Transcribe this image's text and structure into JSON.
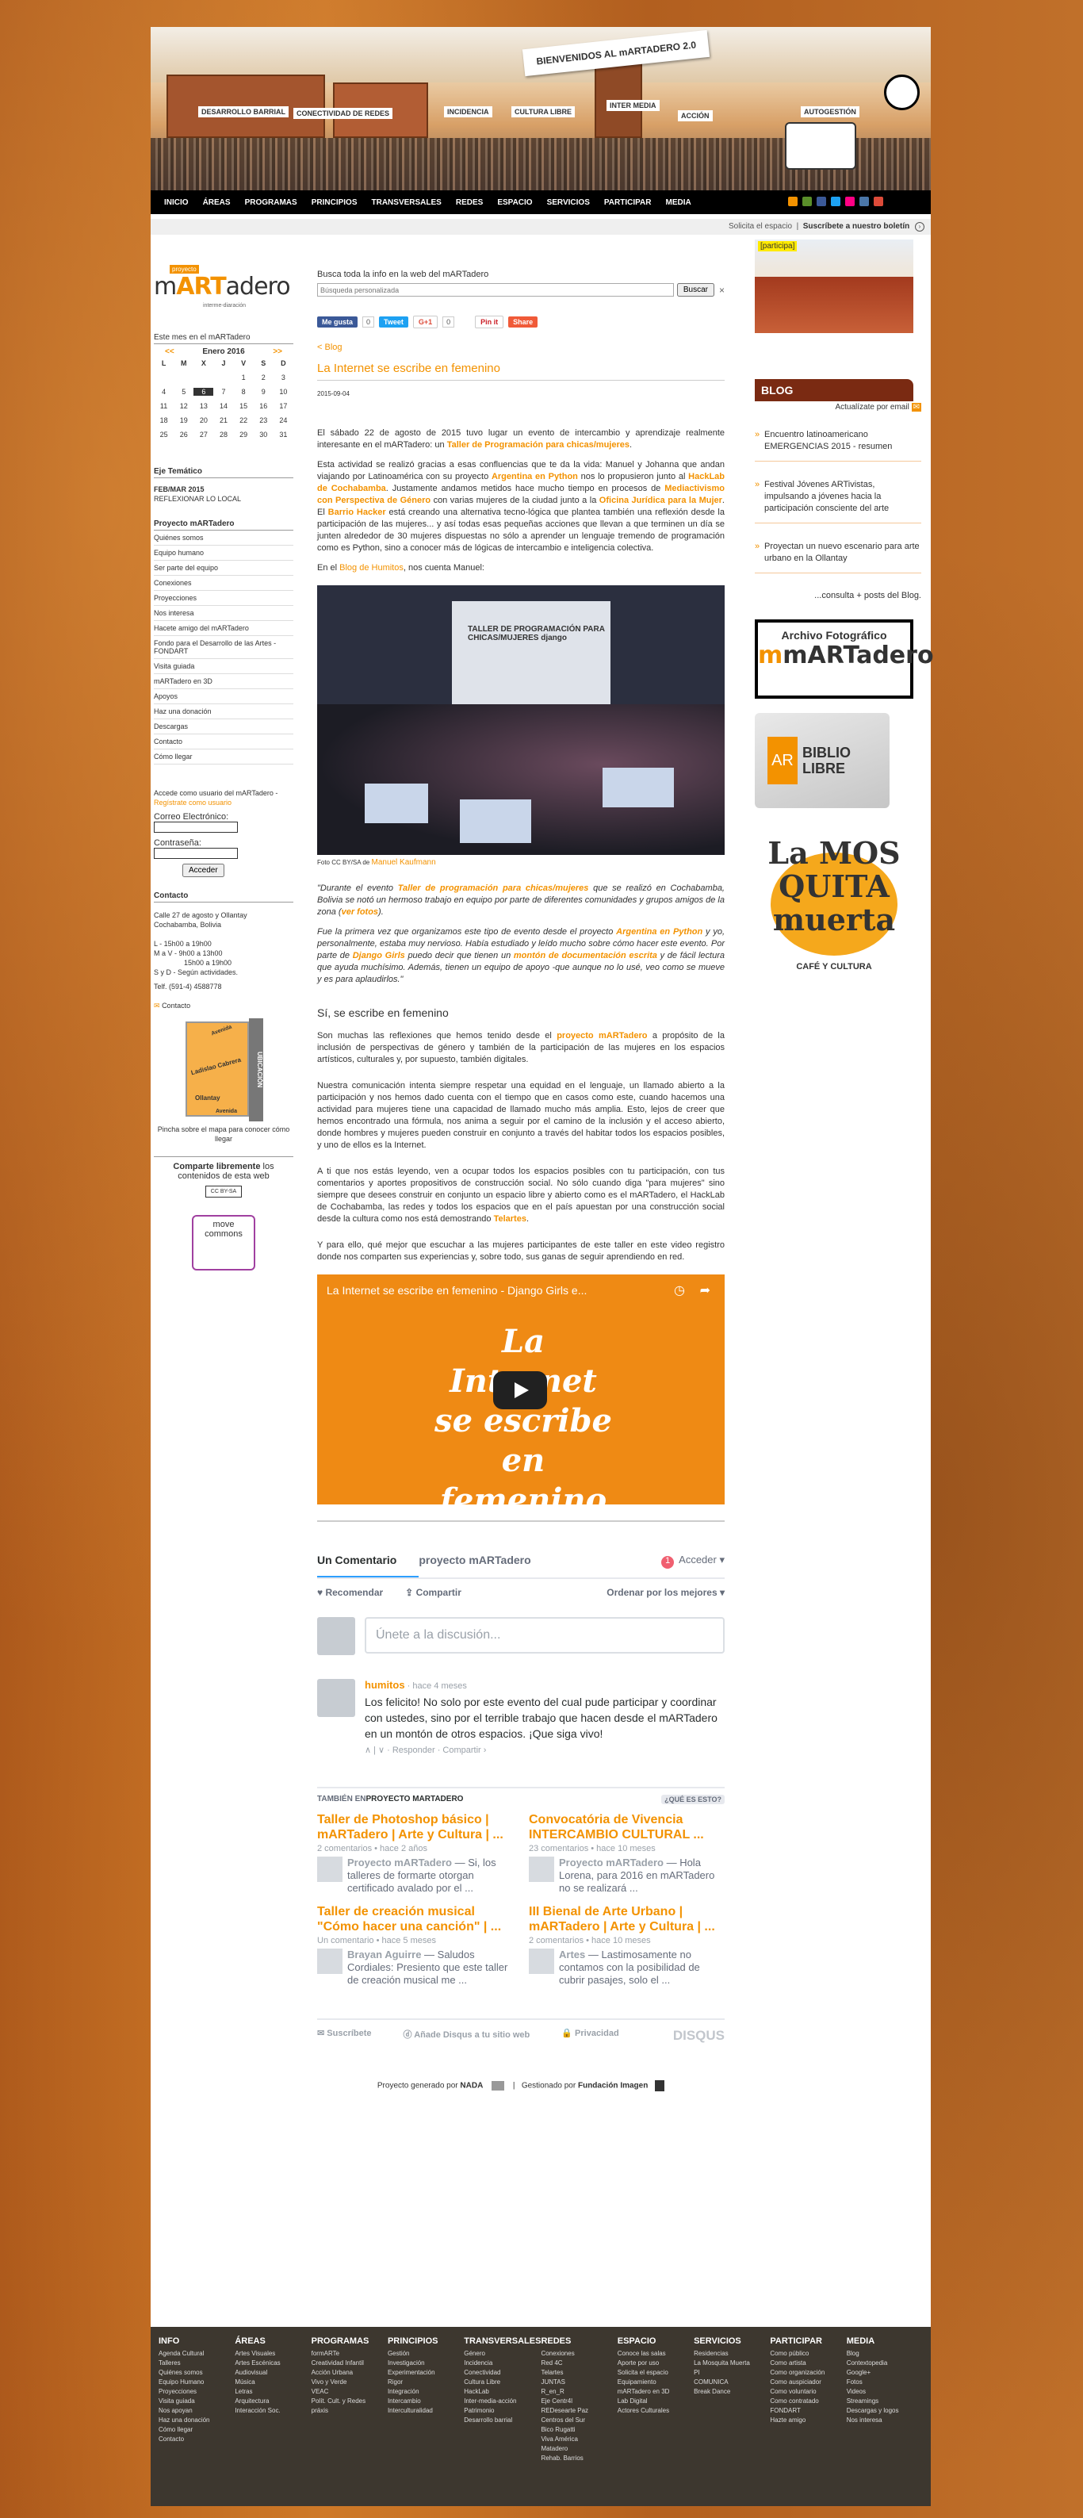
{
  "header": {
    "welcome": "BIENVENIDOS AL mARTADERO 2.0",
    "tags": [
      "DESARROLLO BARRIAL",
      "CONECTIVIDAD DE REDES",
      "INCIDENCIA",
      "CULTURA LIBRE",
      "INTER MEDIA",
      "ACCIÓN",
      "AUTOGESTIÓN"
    ]
  },
  "nav": {
    "items": [
      "INICIO",
      "ÁREAS",
      "PROGRAMAS",
      "PRINCIPIOS",
      "TRANSVERSALES",
      "REDES",
      "ESPACIO",
      "SERVICIOS",
      "PARTICIPAR",
      "MEDIA"
    ]
  },
  "subbar": {
    "request": "Solicita el espacio",
    "subscribe": "Suscríbete a nuestro boletín"
  },
  "left": {
    "logo_proj": "proyecto",
    "logo_main": "mARTadero",
    "logo_sub": "interme-diaración",
    "month_title": "Este mes en el mARTadero",
    "cal_prev": "<<",
    "cal_month": "Enero 2016",
    "cal_next": ">>",
    "cal_days": [
      "L",
      "M",
      "X",
      "J",
      "V",
      "S",
      "D"
    ],
    "cal_cells": [
      "",
      "",
      "",
      "",
      "1",
      "2",
      "3",
      "4",
      "5",
      "6",
      "7",
      "8",
      "9",
      "10",
      "11",
      "12",
      "13",
      "14",
      "15",
      "16",
      "17",
      "18",
      "19",
      "20",
      "21",
      "22",
      "23",
      "24",
      "25",
      "26",
      "27",
      "28",
      "29",
      "30",
      "31"
    ],
    "today": "6",
    "eje_title": "Eje Temático",
    "eje_date": "FEB/MAR 2015",
    "eje_text": "REFLEXIONAR LO LOCAL",
    "proj_title": "Proyecto mARTadero",
    "menu": [
      "Quiénes somos",
      "Equipo humano",
      "Ser parte del equipo",
      "Conexiones",
      "Proyecciones",
      "Nos interesa",
      "Hacete amigo del mARTadero",
      "Fondo para el Desarrollo de las Artes - FONDART",
      "Visita guiada",
      "mARTadero en 3D",
      "Apoyos",
      "Haz una donación",
      "Descargas",
      "Contacto",
      "Cómo llegar"
    ],
    "access_text": "Accede como usuario del mARTadero -",
    "register": "Regístrate como usuario",
    "email_label": "Correo Electrónico:",
    "pass_label": "Contraseña:",
    "login_button": "Acceder",
    "contact_title": "Contacto",
    "contact_address": "Calle 27 de agosto y Ollantay Cochabamba, Bolivia",
    "contact_hours": [
      "L - 15h00 a 19h00",
      "M a V - 9h00 a 13h00",
      "15h00 a 19h00",
      "S y D - Según actividades."
    ],
    "contact_tel": "Telf. (591-4) 4588778",
    "contact_link": "Contacto",
    "map_side": "UBICACIÓN",
    "map_streets": [
      "Ladislao Cabrera",
      "Ollantay",
      "Avenida",
      "Avenida"
    ],
    "map_caption": "Pincha sobre el mapa para conocer cómo llegar",
    "share_bold": "Comparte libremente",
    "share_rest": " los contenidos de esta web",
    "cc_badge": "CC BY-SA",
    "move_commons": "move commons"
  },
  "main": {
    "search_label": "Busca toda la info en la web del mARTadero",
    "search_placeholder": "Búsqueda personalizada",
    "search_button": "Buscar",
    "search_clear": "×",
    "fb_like": "Me gusta",
    "fb_count": "0",
    "tweet": "Tweet",
    "gplus": "G+1",
    "gplus_count": "0",
    "pin": "Pin it",
    "share": "Share",
    "back": "< Blog",
    "title": "La Internet se escribe en femenino",
    "date": "2015-09-04",
    "p1_a": "El sábado 22 de agosto de 2015 tuvo lugar un evento de intercambio y aprendizaje realmente interesante en el mARTadero: un ",
    "p1_link": "Taller de Programación para chicas/mujeres",
    "p1_b": ".",
    "p2_a": "Esta actividad se realizó gracias a esas confluencias que te da la vida: Manuel y Johanna que andan viajando por Latinoamérica con su proyecto ",
    "p2_l1": "Argentina en Python",
    "p2_b": " nos lo propusieron junto al ",
    "p2_l2": "HackLab de Cochabamba",
    "p2_c": ". Justamente andamos metidos hace mucho tiempo en procesos de ",
    "p2_l3": "Mediactivismo con Perspectiva de Género",
    "p2_d": " con varias mujeres de la ciudad junto a la ",
    "p2_l4": "Oficina Jurídica para la Mujer",
    "p2_e": ". El ",
    "p2_l5": "Barrio Hacker",
    "p2_f": " está creando una alternativa tecno-lógica que plantea también una reflexión desde la participación de las mujeres... y así todas esas pequeñas acciones que llevan a que terminen un día se junten alrededor de 30 mujeres dispuestas no sólo a aprender un lenguaje tremendo de programación como es Python, sino a conocer más de lógicas de intercambio e inteligencia colectiva.",
    "p3_a": "En el ",
    "p3_link": "Blog de Humitos",
    "p3_b": ", nos cuenta Manuel:",
    "photo_screen": "TALLER DE PROGRAMACIÓN PARA CHICAS/MUJERES django",
    "caption_a": "Foto CC BY/SA de ",
    "caption_link": "Manuel Kaufmann",
    "q1_a": "\"Durante el evento ",
    "q1_l1": "Taller de programación para chicas/mujeres",
    "q1_b": " que se realizó en Cochabamba, Bolivia se notó un hermoso trabajo en equipo por parte de diferentes comunidades y grupos amigos de la zona (",
    "q1_l2": "ver fotos",
    "q1_c": ").",
    "q2_a": "Fue la primera vez que organizamos este tipo de evento desde el proyecto ",
    "q2_l1": "Argentina en Python",
    "q2_b": " y yo, personalmente, estaba muy nervioso. Había estudiado y leído mucho sobre cómo hacer este evento. Por parte de ",
    "q2_l2": "Django Girls",
    "q2_c": " puedo decir que tienen un ",
    "q2_l3": "montón de documentación escrita",
    "q2_d": " y de fácil lectura que ayuda muchísimo. Además, tienen un equipo de apoyo -que aunque no lo usé, veo como se mueve y es para aplaudirlos.\"",
    "sub_title": "Sí, se escribe en femenino",
    "p4_a": "Son muchas las reflexiones que hemos tenido desde el ",
    "p4_link": "proyecto mARTadero",
    "p4_b": " a propósito de la inclusión de perspectivas de género y también de la participación de las mujeres en los espacios artísticos, culturales y, por supuesto, también digitales.",
    "p5": "Nuestra comunicación intenta siempre respetar una equidad en el lenguaje, un llamado abierto a la participación y nos hemos dado cuenta con el tiempo que en casos como este, cuando hacemos una actividad para mujeres tiene una capacidad de llamado mucho más amplia. Esto, lejos de creer que hemos encontrado una fórmula, nos anima a seguir por el camino de la inclusión y el acceso abierto, donde hombres y mujeres pueden construir en conjunto a través del habitar todos los espacios posibles, y uno de ellos es la Internet.",
    "p6_a": "A ti que nos estás leyendo, ven a ocupar todos los espacios posibles con tu participación, con tus comentarios y aportes propositivos de construcción social. No sólo cuando diga \"para mujeres\" sino siempre que desees construir en conjunto un espacio libre y abierto como es el mARTadero, el HackLab de Cochabamba, las redes y todos los espacios que en el país apuestan por una construcción social desde la cultura como nos está demostrando ",
    "p6_link": "Telartes",
    "p6_b": ".",
    "p7": "Y para ello, qué mejor que escuchar a las mujeres participantes de este taller en este video registro donde nos comparten sus experiencias y, sobre todo, sus ganas de seguir aprendiendo en red.",
    "video_title": "La Internet se escribe en femenino - Django Girls e...",
    "video_big": "La Internet se escribe en femenino"
  },
  "disqus": {
    "tab_comments": "Un Comentario",
    "tab_project": "proyecto mARTadero",
    "notif_count": "1",
    "login": "Acceder",
    "recommend": "Recomendar",
    "share": "Compartir",
    "sort": "Ordenar por los mejores",
    "placeholder": "Únete a la discusión...",
    "comment_author": "humitos",
    "comment_time": "hace 4 meses",
    "comment_text": "Los felicito! No solo por este evento del cual pude participar y coordinar con ustedes, sino por el terrible trabajo que hacen desde el mARTadero en un montón de otros espacios. ¡Que siga vivo!",
    "comment_actions": "∧ | ∨ · Responder · Compartir ›",
    "also_label": "TAMBIÉN EN ",
    "also_provider": "PROYECTO MARTADERO",
    "what_is": "¿QUÉ ES ESTO?",
    "related": [
      {
        "title": "Taller de Photoshop básico | mARTadero | Arte y Cultura | ...",
        "meta": "2 comentarios • hace 2 años",
        "author": "Proyecto mARTadero",
        "snippet": " — Si, los talleres de formarte otorgan certificado avalado por el ..."
      },
      {
        "title": "Convocatória de Vivencia INTERCAMBIO CULTURAL ...",
        "meta": "23 comentarios • hace 10 meses",
        "author": "Proyecto mARTadero",
        "snippet": " — Hola Lorena, para 2016 en mARTadero no se realizará ..."
      },
      {
        "title": "Taller de creación musical \"Cómo hacer una canción\" | ...",
        "meta": "Un comentario • hace 5 meses",
        "author": "Brayan Aguirre",
        "snippet": " — Saludos Cordiales: Presiento que este taller de creación musical me ..."
      },
      {
        "title": "III Bienal de Arte Urbano | mARTadero | Arte y Cultura | ...",
        "meta": "2 comentarios • hace 10 meses",
        "author": "Artes",
        "snippet": " — Lastimosamente no contamos con la posibilidad de cubrir pasajes, solo el ..."
      }
    ],
    "foot_subscribe": "Suscríbete",
    "foot_add": "Añade Disqus a tu sitio web",
    "foot_privacy": "Privacidad",
    "foot_logo": "DISQUS"
  },
  "generated": {
    "by_a": "Proyecto generado por ",
    "by_b": "NADA",
    "sep": "|",
    "managed_a": "Gestionado por ",
    "managed_b": "Fundación Imagen"
  },
  "right": {
    "participa": "[participa]",
    "blog_title": "BLOG",
    "blog_update": "Actualízate por email",
    "posts": [
      "Encuentro latinoamericano EMERGENCIAS 2015 - resumen",
      "Festival Jóvenes ARTivistas, impulsando a jóvenes hacia la participación consciente del arte",
      "Proyectan un nuevo escenario para arte urbano en la Ollantay"
    ],
    "more": "...consulta + posts del Blog.",
    "archivo_t1": "Archivo Fotográfico",
    "archivo_t2": "mARTadero",
    "biblio": "BIBLIO LIBRE",
    "biblio_ar": "AR",
    "mosquita": "La MOS QUITA muerta",
    "cafe": "CAFÉ Y CULTURA"
  },
  "footer": {
    "columns": [
      {
        "title": "INFO",
        "items": [
          "Agenda Cultural",
          "Talleres",
          "Quiénes somos",
          "Equipo Humano",
          "Proyecciones",
          "Visita guiada",
          "Nos apoyan",
          "Haz una donación",
          "Cómo llegar",
          "Contacto"
        ]
      },
      {
        "title": "ÁREAS",
        "items": [
          "Artes Visuales",
          "Artes Escénicas",
          "Audiovisual",
          "Música",
          "Letras",
          "Arquitectura",
          "Interacción Soc."
        ]
      },
      {
        "title": "PROGRAMAS",
        "items": [
          "formARTe",
          "Creatividad Infantil",
          "Acción Urbana",
          "Vivo y Verde",
          "VEAC",
          "Polít. Cult. y Redes",
          "práxis"
        ]
      },
      {
        "title": "PRINCIPIOS",
        "items": [
          "Gestión",
          "Investigación",
          "Experimentación",
          "Rigor",
          "Integración",
          "Intercambio",
          "Interculturalidad"
        ]
      },
      {
        "title": "TRANSVERSALES",
        "items": [
          "Género",
          "Incidencia",
          "Conectividad",
          "Cultura Libre",
          "HackLab",
          "Inter-media-acción",
          "Patrimonio",
          "Desarrollo barrial"
        ]
      },
      {
        "title": "REDES",
        "items": [
          "Conexiones",
          "Red 4C",
          "Telartes",
          "JUNTAS",
          "R_en_R",
          "Eje Centr4l",
          "REDesearte Paz",
          "Centros del Sur",
          "Bico Rugatti",
          "Viva América",
          "Matadero",
          "Rehab. Barrios"
        ]
      },
      {
        "title": "ESPACIO",
        "items": [
          "Conoce las salas",
          "Aporte por uso",
          "Solicita el espacio",
          "Equipamiento",
          "mARTadero en 3D",
          "Lab Digital",
          "Actores Culturales"
        ]
      },
      {
        "title": "SERVICIOS",
        "items": [
          "Residencias",
          "La Mosquita Muerta",
          "PI",
          "COMUNICA",
          "Break Dance"
        ]
      },
      {
        "title": "PARTICIPAR",
        "items": [
          "Como público",
          "Como artista",
          "Como organización",
          "Como auspiciador",
          "Como voluntario",
          "Como contratado",
          "FONDART",
          "Hazte amigo"
        ]
      },
      {
        "title": "MEDIA",
        "items": [
          "Blog",
          "Contextopedia",
          "Google+",
          "Fotos",
          "Videos",
          "Streamings",
          "Descargas y logos",
          "Nos interesa"
        ]
      }
    ]
  },
  "colors": {
    "accent": "#f39200",
    "nav_bg": "#000000",
    "footer_bg": "#3d372f",
    "blog_header": "#7a2a12",
    "page_bg": "#b8601c"
  }
}
